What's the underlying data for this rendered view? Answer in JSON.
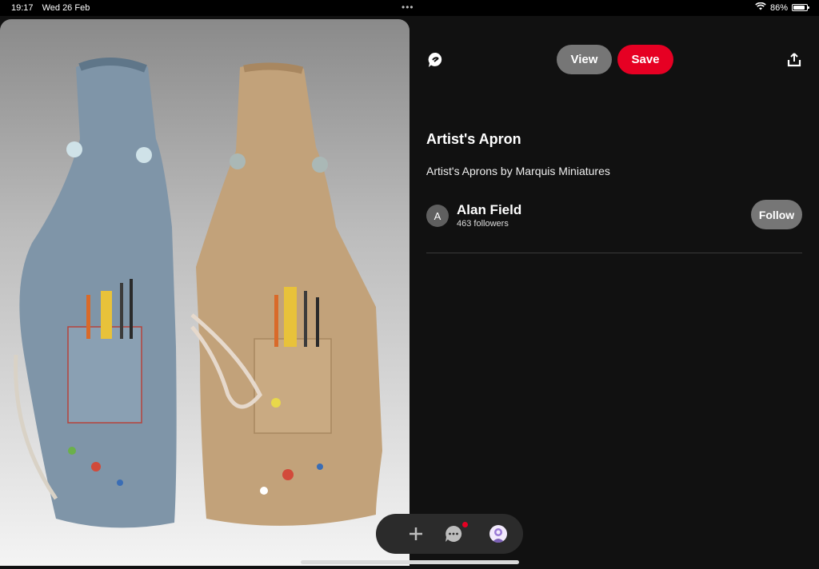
{
  "status_bar": {
    "time": "19:17",
    "date": "Wed 26 Feb",
    "battery_percent": "86%",
    "battery_level": 0.86
  },
  "pin": {
    "image_icon": "artist-apron-photo",
    "title": "Artist's Apron",
    "description": "Artist's Aprons by Marquis Miniatures"
  },
  "actions": {
    "view_label": "View",
    "save_label": "Save"
  },
  "creator": {
    "avatar_letter": "A",
    "name": "Alan Field",
    "followers": "463 followers",
    "follow_label": "Follow"
  },
  "colors": {
    "save": "#e60023",
    "pill": "#767676",
    "background": "#111111",
    "notification_dot": "#e60023"
  },
  "nav": {
    "items": [
      "create-icon",
      "messages-icon",
      "profile-avatar"
    ],
    "messages_has_notification": true
  }
}
